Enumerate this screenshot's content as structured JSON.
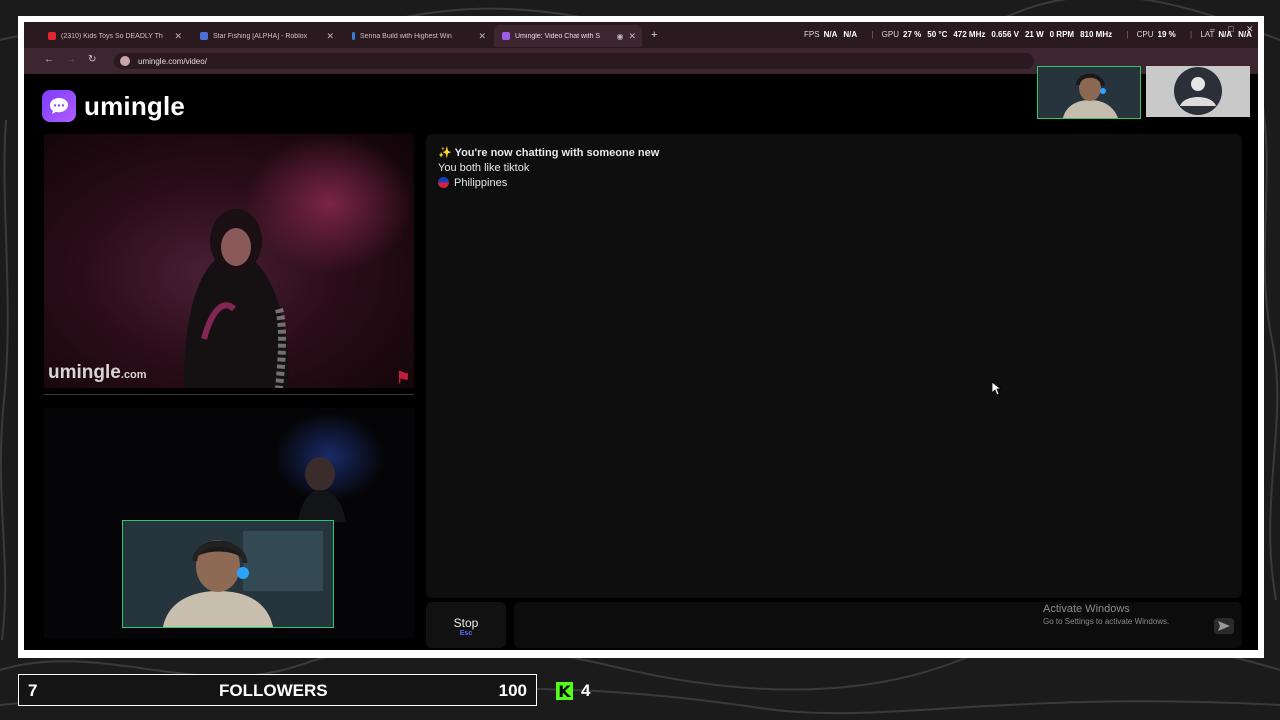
{
  "browser": {
    "tabs": [
      {
        "label": "(2310) Kids Toys So DEADLY Th",
        "favicon_color": "#e0262e",
        "active": false
      },
      {
        "label": "Star Fishing [ALPHA] - Roblox",
        "favicon_color": "#4f6fd8",
        "active": false
      },
      {
        "label": "Senna Build with Highest Win",
        "favicon_color": "#3a7bd5",
        "active": false
      },
      {
        "label": "Umingle: Video Chat with S",
        "favicon_color": "#9b5de5",
        "active": true
      }
    ],
    "new_tab": "+",
    "url": "umingle.com/video/",
    "window_controls": [
      "–",
      "□",
      "✕"
    ]
  },
  "hw_stats": {
    "fps_label": "FPS",
    "fps_value1": "N/A",
    "fps_value2": "N/A",
    "gpu_label": "GPU",
    "gpu_usage": "27 %",
    "gpu_temp": "50 °C",
    "gpu_clock": "472 MHz",
    "gpu_volt": "0.656 V",
    "gpu_power": "21 W",
    "gpu_fan": "0 RPM",
    "gpu_mem": "810 MHz",
    "cpu_label": "CPU",
    "cpu_usage": "19 %",
    "lat_label": "LAT",
    "lat_value1": "N/A",
    "lat_value2": "N/A"
  },
  "page": {
    "logo_text": "umingle",
    "watermark": "umingle",
    "watermark_suffix": ".com",
    "chat": {
      "line1": "You're now chatting with someone new",
      "line2": "You both like tiktok",
      "line3": "Philippines"
    },
    "stop_label": "Stop",
    "stop_shortcut": "Esc",
    "activate_title": "Activate Windows",
    "activate_sub": "Go to Settings to activate Windows."
  },
  "overlay": {
    "followers_current": "7",
    "followers_label": "FOLLOWERS",
    "followers_goal": "100",
    "kick_count": "4",
    "kick_color": "#53fc18"
  }
}
